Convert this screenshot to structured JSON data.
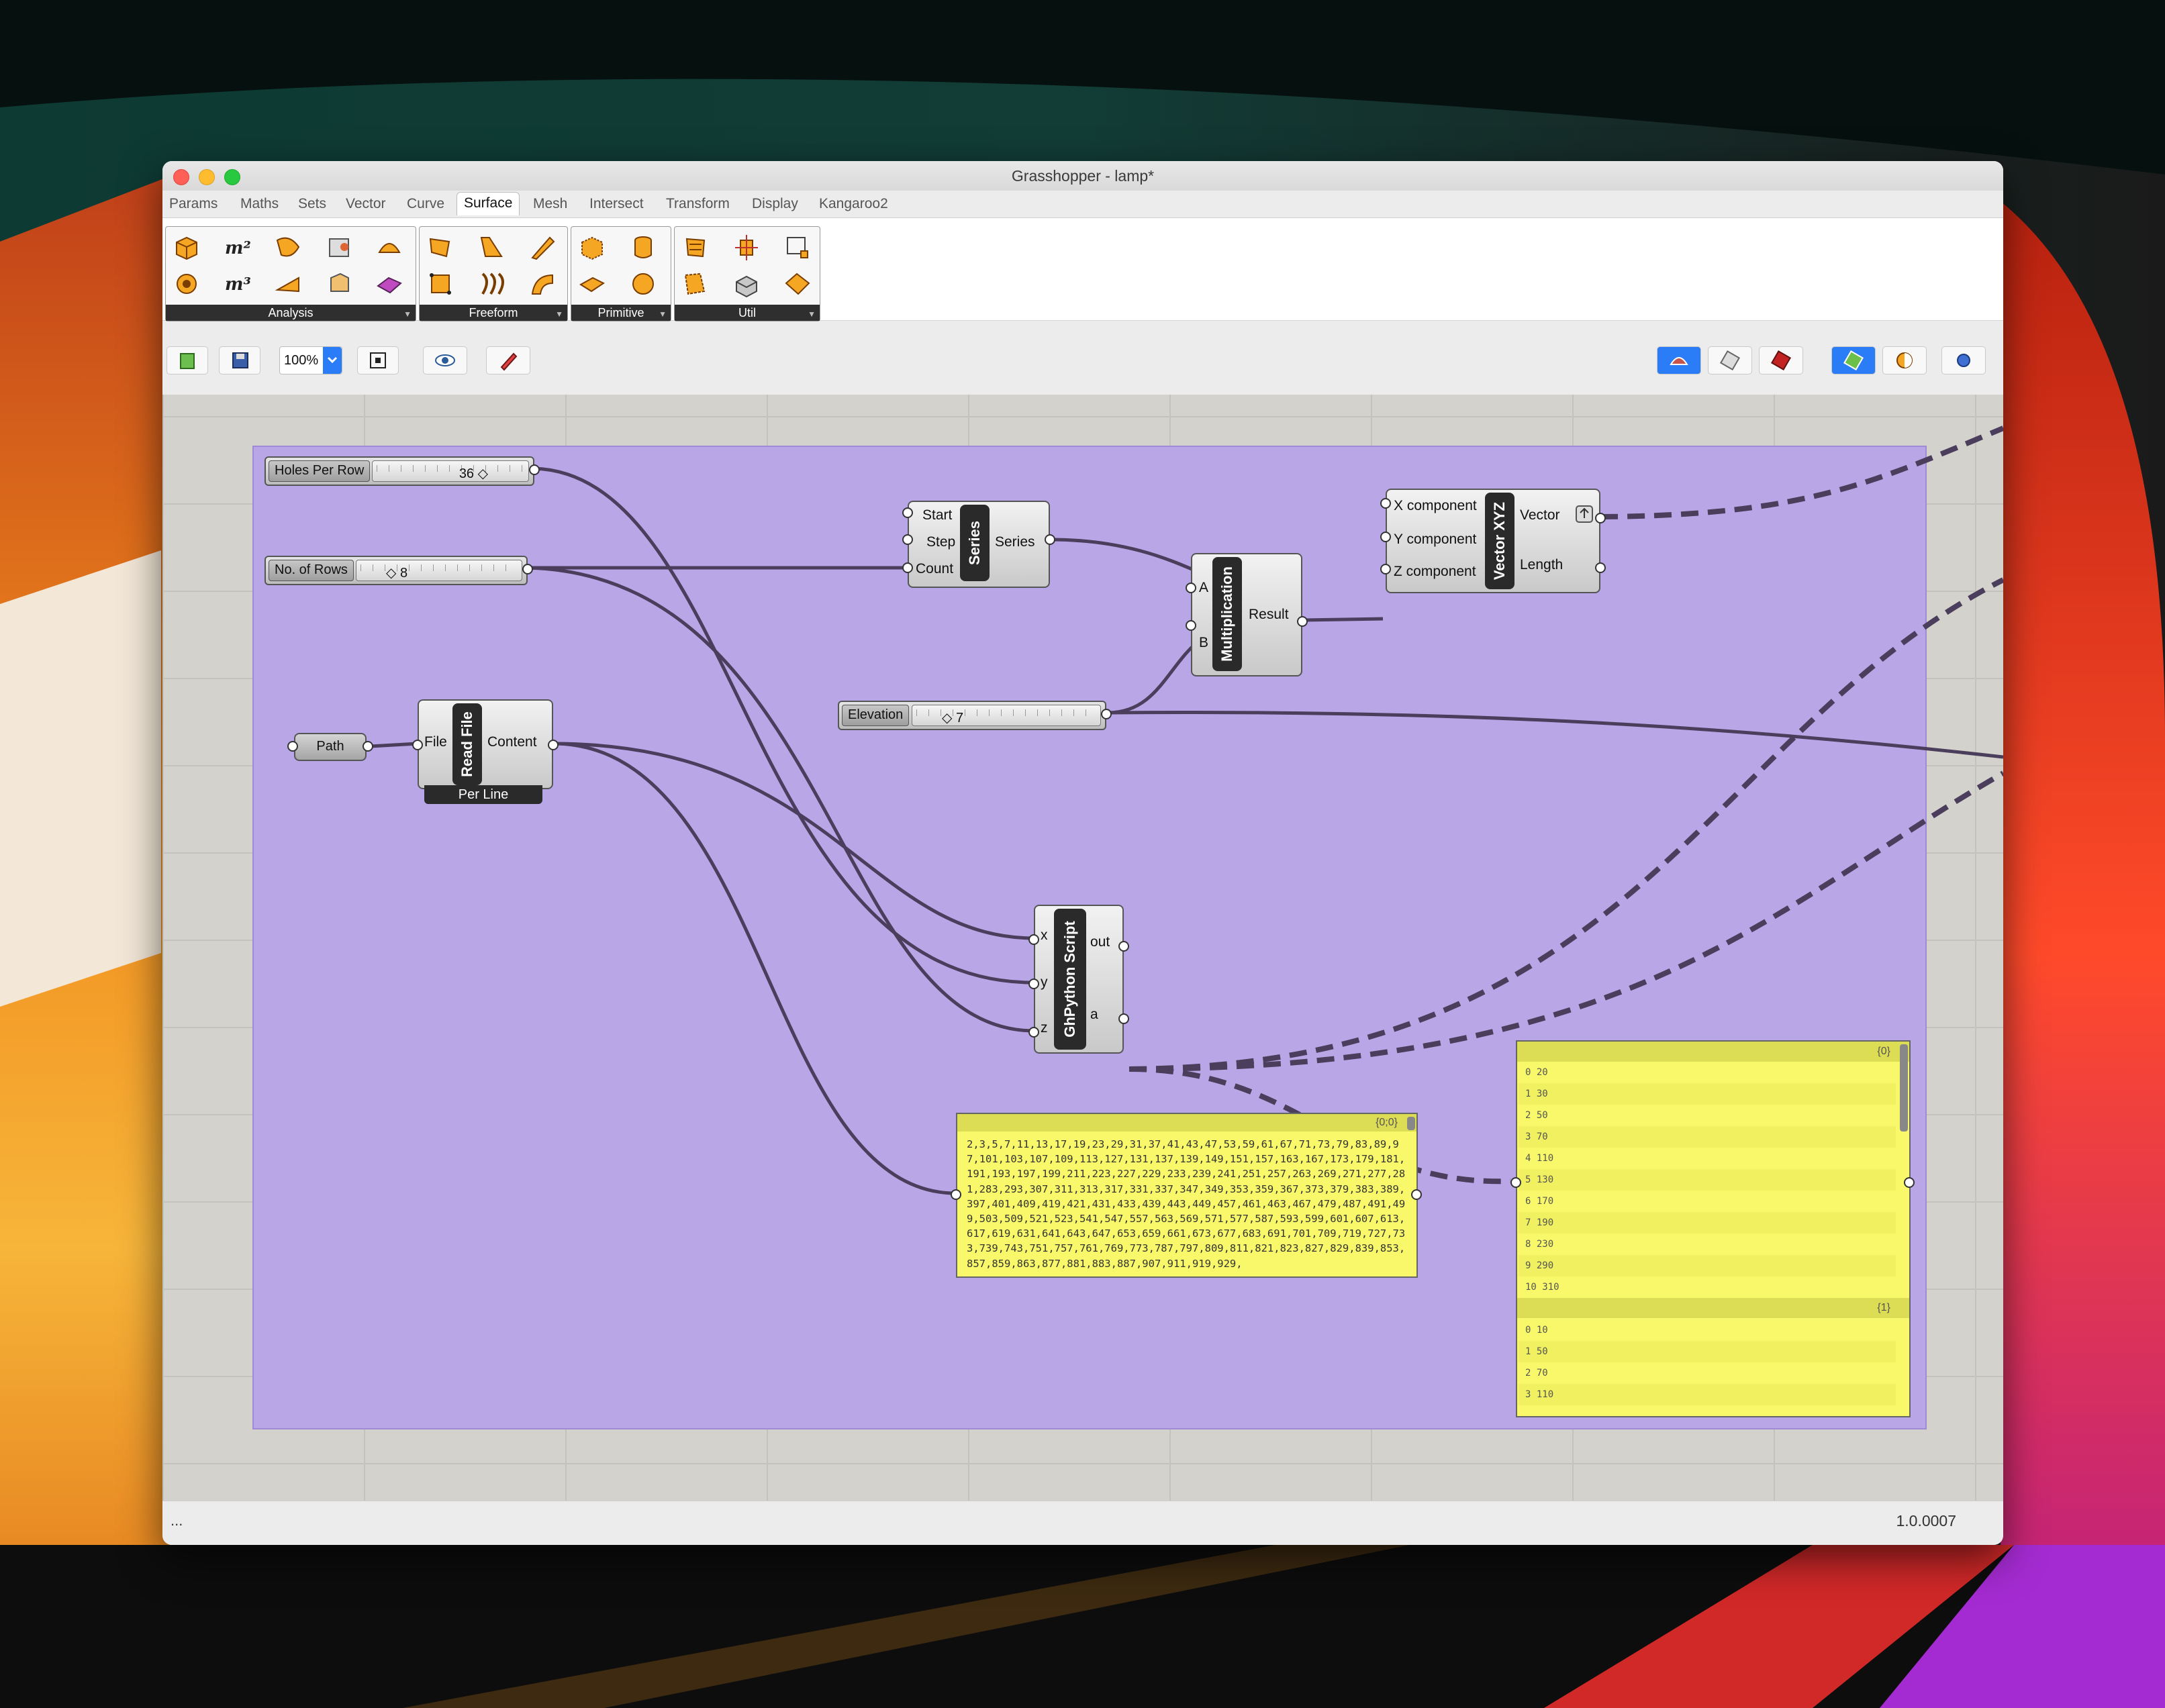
{
  "window": {
    "title": "Grasshopper - lamp*"
  },
  "tabs": [
    "Params",
    "Maths",
    "Sets",
    "Vector",
    "Curve",
    "Surface",
    "Mesh",
    "Intersect",
    "Transform",
    "Display",
    "Kangaroo2"
  ],
  "active_tab": "Surface",
  "ribbon": {
    "groups": [
      {
        "label": "Analysis",
        "icons": [
          "box-icon",
          "area-icon",
          "evaluate-icon",
          "surface-closest-icon",
          "deconstruct-icon",
          "shape-in-brep-icon",
          "volume-icon",
          "point-in-brep-icon",
          "brep-edges-icon",
          "dimensions-icon"
        ]
      },
      {
        "label": "Freeform",
        "icons": [
          "edge-surface-icon",
          "loft-icon",
          "extrude-icon",
          "surface-from-points-icon",
          "network-surface-icon",
          "sweep-icon"
        ]
      },
      {
        "label": "Primitive",
        "icons": [
          "bounding-box-icon",
          "cylinder-icon",
          "plane-surface-icon",
          "sphere-icon"
        ]
      },
      {
        "label": "Util",
        "icons": [
          "divide-surface-icon",
          "surface-frames-icon",
          "isotrim-icon",
          "offset-surface-icon",
          "brep-join-icon",
          "copy-trim-icon"
        ]
      }
    ]
  },
  "toolbar": {
    "zoom": "100%"
  },
  "canvas": {
    "sliders": [
      {
        "name": "Holes Per Row",
        "value": "36 ◇"
      },
      {
        "name": "No. of Rows",
        "value": "◇ 8"
      },
      {
        "name": "Elevation",
        "value": "◇ 7"
      }
    ],
    "path_param": "Path",
    "series": {
      "title": "Series",
      "inputs": [
        "Start",
        "Step",
        "Count"
      ],
      "outputs": [
        "Series"
      ]
    },
    "multiplication": {
      "title": "Multiplication",
      "inputs": [
        "A",
        "B"
      ],
      "outputs": [
        "Result"
      ]
    },
    "vector": {
      "title": "Vector XYZ",
      "inputs": [
        "X component",
        "Y component",
        "Z component"
      ],
      "outputs": [
        "Vector",
        "Length"
      ]
    },
    "readfile": {
      "title": "Read File",
      "inputs": [
        "File"
      ],
      "outputs": [
        "Content"
      ],
      "footer": "Per Line"
    },
    "python": {
      "title": "GhPython Script",
      "inputs": [
        "x",
        "y",
        "z"
      ],
      "outputs": [
        "out",
        "a"
      ]
    },
    "panel_text": {
      "header": "{0;0}",
      "text": "2,3,5,7,11,13,17,19,23,29,31,37,41,43,47,53,59,61,67,71,73,79,83,89,97,101,103,107,109,113,127,131,137,139,149,151,157,163,167,173,179,181,191,193,197,199,211,223,227,229,233,239,241,251,257,263,269,271,277,281,283,293,307,311,313,317,331,337,347,349,353,359,367,373,379,383,389,397,401,409,419,421,431,433,439,443,449,457,461,463,467,479,487,491,499,503,509,521,523,541,547,557,563,569,571,577,587,593,599,601,607,613,617,619,631,641,643,647,653,659,661,673,677,683,691,701,709,719,727,733,739,743,751,757,761,769,773,787,797,809,811,821,823,827,829,839,853,857,859,863,877,881,883,887,907,911,919,929,"
    },
    "panel_list": {
      "branch0": "{0}",
      "rows0": [
        "0 20",
        "1 30",
        "2 50",
        "3 70",
        "4 110",
        "5 130",
        "6 170",
        "7 190",
        "8 230",
        "9 290",
        "10 310"
      ],
      "branch1": "{1}",
      "rows1": [
        "0 10",
        "1 50",
        "2 70",
        "3 110"
      ]
    }
  },
  "status": {
    "left": "...",
    "right": "1.0.0007"
  }
}
